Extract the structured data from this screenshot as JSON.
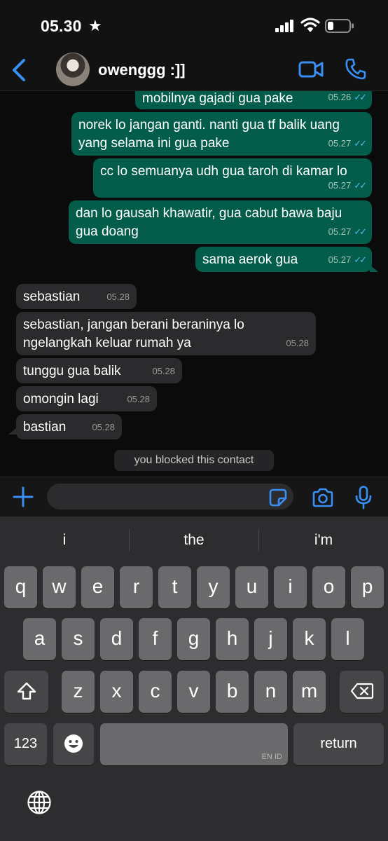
{
  "status_bar": {
    "time": "05.30",
    "star": "★"
  },
  "header": {
    "contact_name": "owenggg :]]"
  },
  "messages": [
    {
      "dir": "out",
      "text": "mobilnya gajadi gua pake",
      "time": "05.26",
      "ticks": "✓✓"
    },
    {
      "dir": "out",
      "text": "norek lo jangan ganti. nanti gua tf balik uang yang selama ini gua pake",
      "time": "05.27",
      "ticks": "✓✓"
    },
    {
      "dir": "out",
      "text": "cc lo semuanya udh gua taroh di kamar lo",
      "time": "05.27",
      "ticks": "✓✓"
    },
    {
      "dir": "out",
      "text": "dan lo gausah khawatir, gua cabut bawa baju gua doang",
      "time": "05.27",
      "ticks": "✓✓"
    },
    {
      "dir": "out",
      "text": "sama aerok gua",
      "time": "05.27",
      "ticks": "✓✓"
    },
    {
      "dir": "in",
      "text": "sebastian",
      "time": "05.28"
    },
    {
      "dir": "in",
      "text": "sebastian, jangan berani beraninya lo ngelangkah keluar rumah ya",
      "time": "05.28"
    },
    {
      "dir": "in",
      "text": "tunggu gua balik",
      "time": "05.28"
    },
    {
      "dir": "in",
      "text": "omongin lagi",
      "time": "05.28"
    },
    {
      "dir": "in",
      "text": "bastian",
      "time": "05.28"
    }
  ],
  "system_notice": "you blocked this contact",
  "input": {
    "value": "",
    "placeholder": ""
  },
  "keyboard": {
    "suggestions": [
      "i",
      "the",
      "i'm"
    ],
    "row1": [
      "q",
      "w",
      "e",
      "r",
      "t",
      "y",
      "u",
      "i",
      "o",
      "p"
    ],
    "row2": [
      "a",
      "s",
      "d",
      "f",
      "g",
      "h",
      "j",
      "k",
      "l"
    ],
    "row3": [
      "z",
      "x",
      "c",
      "v",
      "b",
      "n",
      "m"
    ],
    "numbers_label": "123",
    "space_label": "EN ID",
    "return_label": "return"
  },
  "icons": {
    "back": "chevron-left-icon",
    "video": "video-camera-icon",
    "call": "phone-icon",
    "plus": "plus-icon",
    "sticker": "sticker-icon",
    "camera": "camera-icon",
    "mic": "microphone-icon",
    "shift": "shift-icon",
    "delete": "backspace-icon",
    "emoji": "emoji-icon",
    "globe": "globe-icon"
  },
  "colors": {
    "accent": "#3a8ff5",
    "outgoing_bubble": "#045c4a",
    "incoming_bubble": "#2b2b2d",
    "read_ticks": "#53bdeb"
  }
}
